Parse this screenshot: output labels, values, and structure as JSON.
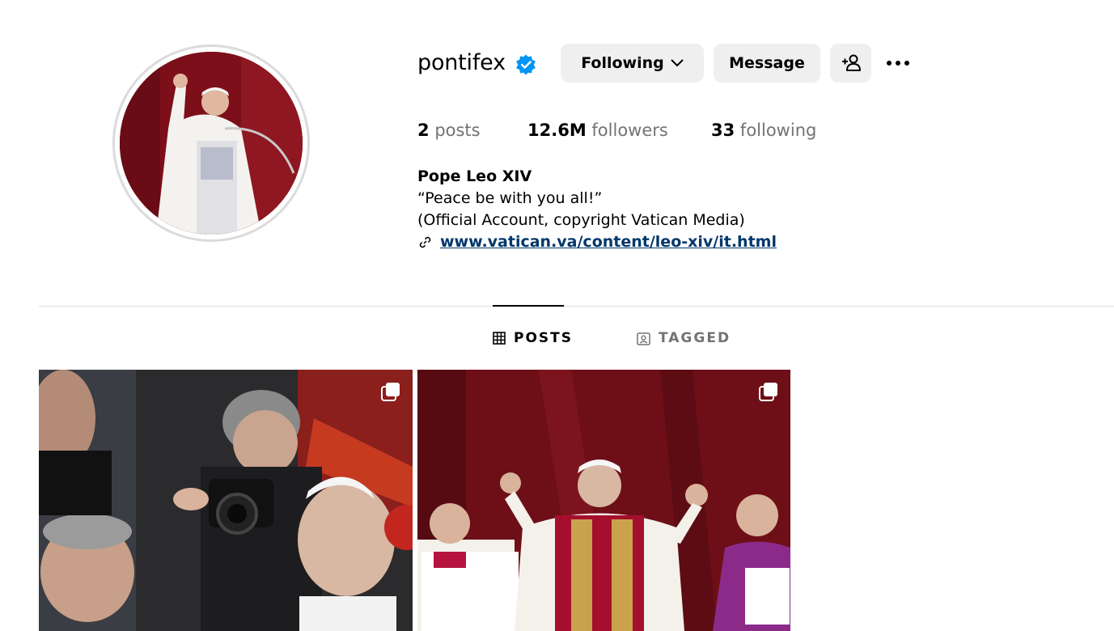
{
  "profile": {
    "username": "pontifex",
    "verified": true,
    "avatar_alt": "profile photo",
    "buttons": {
      "following_label": "Following",
      "message_label": "Message"
    },
    "icons": {
      "verified": "verified-badge-icon",
      "following_chevron": "chevron-down-icon",
      "add_user": "add-user-icon",
      "more": "more-options-icon"
    },
    "stats": {
      "posts_count": "2",
      "posts_label": "posts",
      "followers_count": "12.6M",
      "followers_label": "followers",
      "following_count": "33",
      "following_label": "following"
    },
    "bio": {
      "full_name": "Pope Leo XIV",
      "line1": "“Peace be with you all!”",
      "line2": "(Official Account, copyright Vatican Media)",
      "link_text": "www.vatican.va/content/leo-xiv/it.html"
    }
  },
  "tabs": [
    {
      "label": "POSTS",
      "icon": "grid-icon",
      "active": true
    },
    {
      "label": "TAGGED",
      "icon": "tagged-icon",
      "active": false
    }
  ],
  "posts": [
    {
      "type": "carousel",
      "icon": "carousel-icon"
    },
    {
      "type": "carousel",
      "icon": "carousel-icon"
    }
  ],
  "colors": {
    "accent_blue": "#0095f6",
    "link": "#00376b",
    "button_bg": "#efefef",
    "muted_text": "#737373",
    "divider": "#dbdbdb"
  }
}
